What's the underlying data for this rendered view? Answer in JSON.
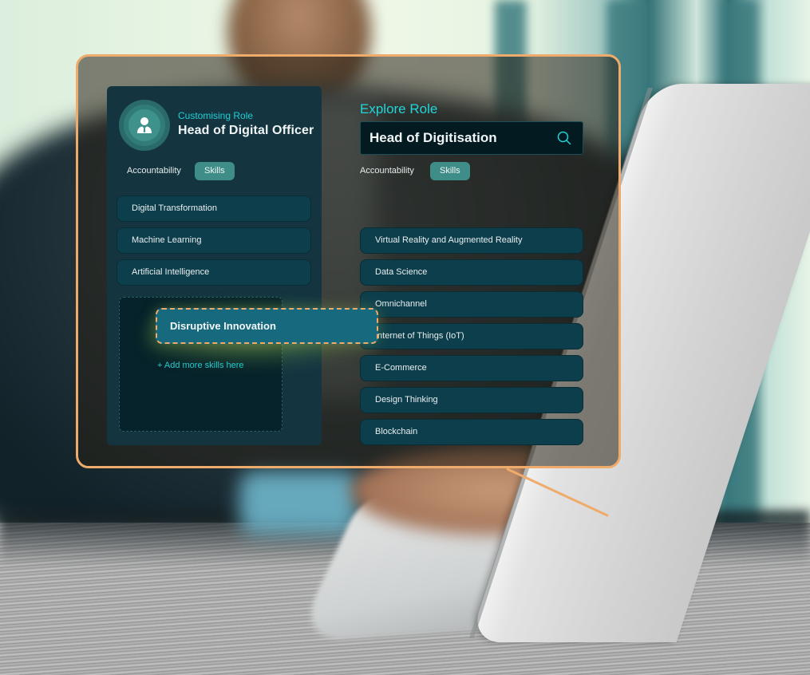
{
  "customising_panel": {
    "label": "Customising Role",
    "role_title": "Head of Digital Officer",
    "avatar_icon": "user-tie-icon",
    "tabs": [
      {
        "label": "Accountability",
        "active": false
      },
      {
        "label": "Skills",
        "active": true
      }
    ],
    "skills": [
      "Digital Transformation",
      "Machine Learning",
      "Artificial Intelligence"
    ],
    "drop_zone": {
      "add_more_label": "+ Add more skills here"
    }
  },
  "dragging_skill": {
    "label": "Disruptive Innovation"
  },
  "explore_panel": {
    "label": "Explore Role",
    "search": {
      "value": "Head of Digitisation",
      "icon": "search-icon"
    },
    "tabs": [
      {
        "label": "Accountability",
        "active": false
      },
      {
        "label": "Skills",
        "active": true
      }
    ],
    "skills": [
      "Virtual Reality and Augmented Reality",
      "Data Science",
      "Omnichannel",
      "Internet of Things (IoT)",
      "E-Commerce",
      "Design Thinking",
      "Blockchain"
    ]
  },
  "colors": {
    "accent_cyan": "#21d6d8",
    "frame_orange": "#eeab6b",
    "panel_bg": "#143540",
    "skill_bg": "#0d3e4c",
    "pill_bg": "#3f8d88",
    "drag_card_bg": "#176a7e"
  }
}
